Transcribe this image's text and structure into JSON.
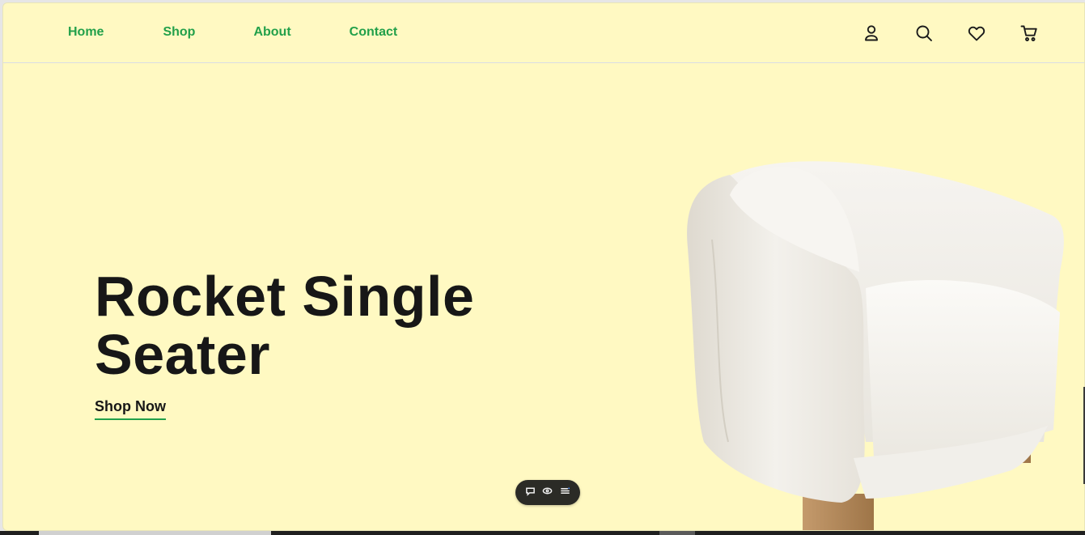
{
  "nav": {
    "items": [
      {
        "label": "Home"
      },
      {
        "label": "Shop"
      },
      {
        "label": "About"
      },
      {
        "label": "Contact"
      }
    ]
  },
  "header_icons": [
    "account-icon",
    "search-icon",
    "heart-icon",
    "cart-icon"
  ],
  "hero": {
    "title_line1": "Rocket Single",
    "title_line2": "Seater",
    "cta_label": "Shop Now"
  },
  "colors": {
    "background": "#fff9c2",
    "nav_accent": "#22a04a",
    "text": "#171717",
    "toolbar": "#2b2b26"
  },
  "floating_toolbar": {
    "icons": [
      "comment-icon",
      "eye-icon",
      "menu-icon"
    ]
  }
}
